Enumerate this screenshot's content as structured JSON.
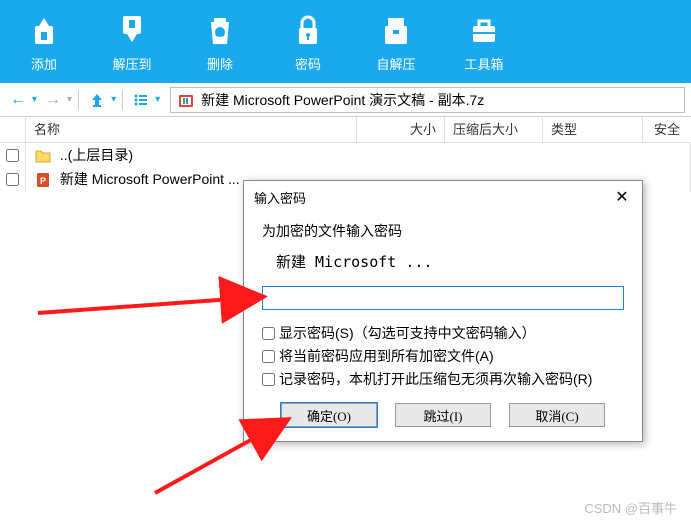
{
  "toolbar": {
    "items": [
      {
        "label": "添加",
        "icon": "add-icon"
      },
      {
        "label": "解压到",
        "icon": "extract-icon"
      },
      {
        "label": "删除",
        "icon": "delete-icon"
      },
      {
        "label": "密码",
        "icon": "lock-icon"
      },
      {
        "label": "自解压",
        "icon": "sfx-icon"
      },
      {
        "label": "工具箱",
        "icon": "toolbox-icon"
      }
    ]
  },
  "address_bar": {
    "path": "新建 Microsoft PowerPoint 演示文稿 - 副本.7z"
  },
  "columns": {
    "name": "名称",
    "size": "大小",
    "packed": "压缩后大小",
    "type": "类型",
    "safe": "安全"
  },
  "files": {
    "parent": "..(上层目录)",
    "row1": "新建 Microsoft PowerPoint ..."
  },
  "dialog": {
    "title": "输入密码",
    "prompt": "为加密的文件输入密码",
    "filename": "新建 Microsoft ...",
    "check1": "显示密码(S)（勾选可支持中文密码输入）",
    "check2": "将当前密码应用到所有加密文件(A)",
    "check3": "记录密码，本机打开此压缩包无须再次输入密码(R)",
    "ok": "确定(O)",
    "skip": "跳过(I)",
    "cancel": "取消(C)"
  },
  "watermark": "CSDN @百事牛"
}
